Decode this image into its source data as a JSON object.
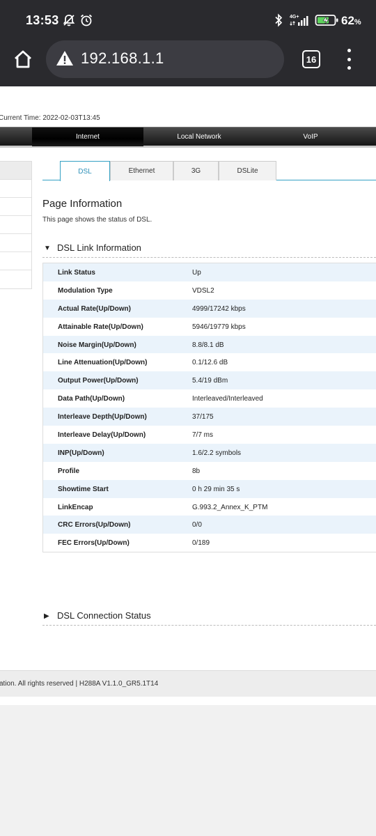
{
  "status_bar": {
    "time": "13:53",
    "network": "4G+",
    "battery_percent": "62",
    "battery_unit": "%"
  },
  "browser": {
    "url": "192.168.1.1",
    "tab_count": "16"
  },
  "router_page": {
    "current_time": "Current Time: 2022-02-03T13:45",
    "nav": {
      "internet": "Internet",
      "local_network": "Local Network",
      "voip": "VoIP"
    },
    "subtabs": [
      "DSL",
      "Ethernet",
      "3G",
      "DSLite"
    ],
    "page_title": "Page Information",
    "page_desc": "This page shows the status of DSL.",
    "section_link": "DSL Link Information",
    "section_conn": "DSL Connection Status",
    "rows": [
      {
        "key": "Link Status",
        "value": "Up"
      },
      {
        "key": "Modulation Type",
        "value": "VDSL2"
      },
      {
        "key": "Actual Rate(Up/Down)",
        "value": "4999/17242 kbps"
      },
      {
        "key": "Attainable Rate(Up/Down)",
        "value": "5946/19779 kbps"
      },
      {
        "key": "Noise Margin(Up/Down)",
        "value": "8.8/8.1 dB"
      },
      {
        "key": "Line Attenuation(Up/Down)",
        "value": "0.1/12.6 dB"
      },
      {
        "key": "Output Power(Up/Down)",
        "value": "5.4/19 dBm"
      },
      {
        "key": "Data Path(Up/Down)",
        "value": "Interleaved/Interleaved"
      },
      {
        "key": "Interleave Depth(Up/Down)",
        "value": "37/175"
      },
      {
        "key": "Interleave Delay(Up/Down)",
        "value": "7/7 ms"
      },
      {
        "key": "INP(Up/Down)",
        "value": "1.6/2.2 symbols"
      },
      {
        "key": "Profile",
        "value": "8b"
      },
      {
        "key": "Showtime Start",
        "value": "0 h 29 min 35 s"
      },
      {
        "key": "LinkEncap",
        "value": "G.993.2_Annex_K_PTM"
      },
      {
        "key": "CRC Errors(Up/Down)",
        "value": "0/0"
      },
      {
        "key": "FEC Errors(Up/Down)",
        "value": "0/189"
      }
    ],
    "footer": "ation. All rights reserved  |   H288A V1.1.0_GR5.1T14"
  }
}
